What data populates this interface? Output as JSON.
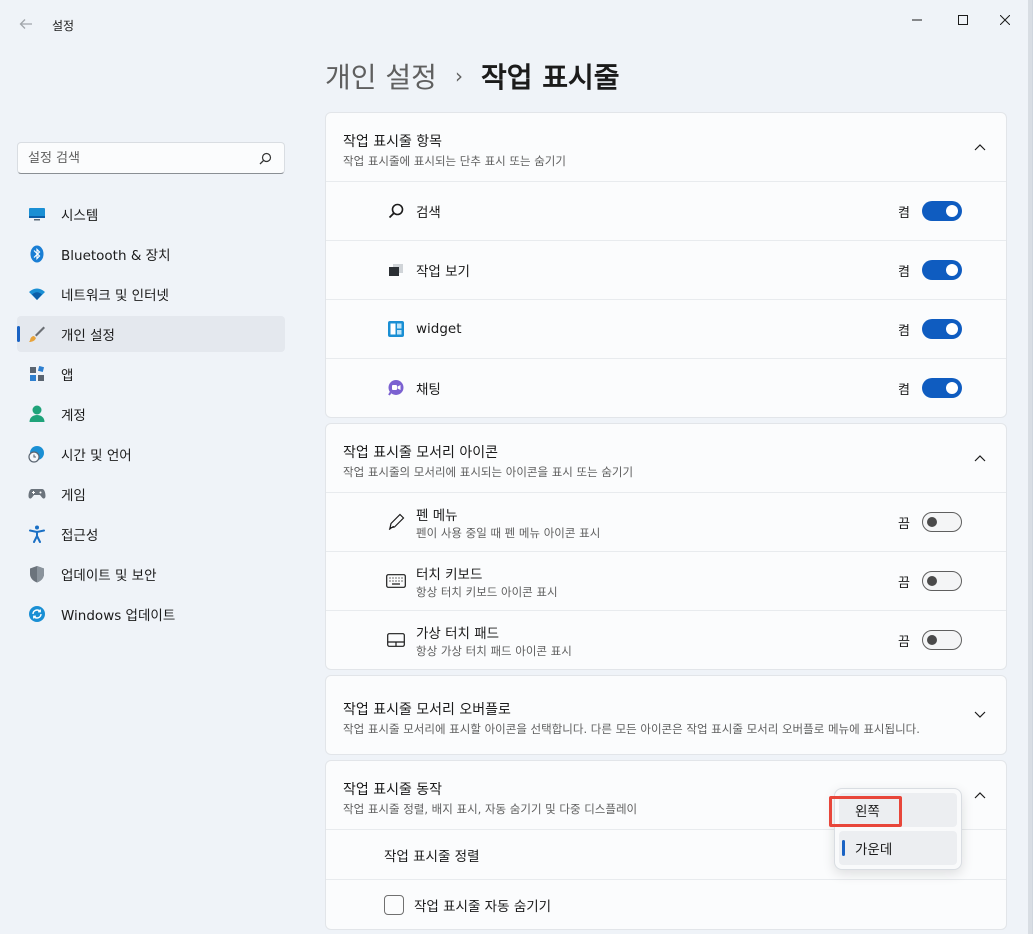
{
  "window": {
    "title": "설정"
  },
  "breadcrumb": {
    "parent": "개인 설정",
    "separator": "›",
    "current": "작업 표시줄"
  },
  "search": {
    "placeholder": "설정 검색"
  },
  "sidebar": {
    "items": [
      {
        "label": "시스템",
        "icon": "monitor-icon"
      },
      {
        "label": "Bluetooth & 장치",
        "icon": "bluetooth-icon"
      },
      {
        "label": "네트워크 및 인터넷",
        "icon": "wifi-icon"
      },
      {
        "label": "개인 설정",
        "icon": "brush-icon",
        "active": true
      },
      {
        "label": "앱",
        "icon": "apps-icon"
      },
      {
        "label": "계정",
        "icon": "account-icon"
      },
      {
        "label": "시간 및 언어",
        "icon": "globe-clock-icon"
      },
      {
        "label": "게임",
        "icon": "gamepad-icon"
      },
      {
        "label": "접근성",
        "icon": "accessibility-icon"
      },
      {
        "label": "업데이트 및 보안",
        "icon": "shield-icon"
      },
      {
        "label": "Windows 업데이트",
        "icon": "update-icon"
      }
    ]
  },
  "sections": {
    "taskbar_items": {
      "title": "작업 표시줄 항목",
      "subtitle": "작업 표시줄에 표시되는 단추 표시 또는 숨기기",
      "rows": [
        {
          "label": "검색",
          "state": "켬",
          "on": true
        },
        {
          "label": "작업 보기",
          "state": "켬",
          "on": true
        },
        {
          "label": "widget",
          "state": "켬",
          "on": true
        },
        {
          "label": "채팅",
          "state": "켬",
          "on": true
        }
      ]
    },
    "corner_icons": {
      "title": "작업 표시줄 모서리 아이콘",
      "subtitle": "작업 표시줄의 모서리에 표시되는 아이콘을 표시 또는 숨기기",
      "rows": [
        {
          "label": "펜 메뉴",
          "desc": "펜이 사용 중일 때 펜 메뉴 아이콘 표시",
          "state": "끔",
          "on": false
        },
        {
          "label": "터치 키보드",
          "desc": "항상 터치 키보드 아이콘 표시",
          "state": "끔",
          "on": false
        },
        {
          "label": "가상 터치 패드",
          "desc": "항상 가상 터치 패드 아이콘 표시",
          "state": "끔",
          "on": false
        }
      ]
    },
    "corner_overflow": {
      "title": "작업 표시줄 모서리 오버플로",
      "subtitle": "작업 표시줄 모서리에 표시할 아이콘을 선택합니다. 다른 모든 아이콘은 작업 표시줄 모서리 오버플로 메뉴에 표시됩니다."
    },
    "behaviors": {
      "title": "작업 표시줄 동작",
      "subtitle": "작업 표시줄 정렬, 배지 표시, 자동 숨기기 및 다중 디스플레이",
      "alignment_label": "작업 표시줄 정렬",
      "autohide_label": "작업 표시줄 자동 숨기기"
    }
  },
  "alignment_dropdown": {
    "options": [
      "왼쪽",
      "가운데"
    ],
    "selected": "가운데"
  },
  "colors": {
    "accent": "#0f5cc0",
    "highlight": "#e8463a"
  }
}
